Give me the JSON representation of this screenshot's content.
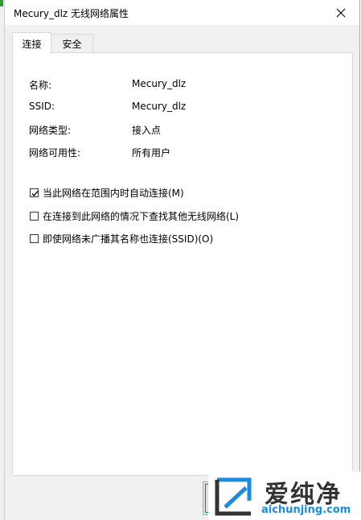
{
  "window": {
    "title": "Mecury_dlz 无线网络属性",
    "close_glyph": "✕"
  },
  "tabs": [
    {
      "label": "连接",
      "active": true
    },
    {
      "label": "安全",
      "active": false
    }
  ],
  "properties": [
    {
      "label": "名称:",
      "value": "Mecury_dlz"
    },
    {
      "label": "SSID:",
      "value": "Mecury_dlz"
    },
    {
      "label": "网络类型:",
      "value": "接入点"
    },
    {
      "label": "网络可用性:",
      "value": "所有用户"
    }
  ],
  "options": [
    {
      "label": "当此网络在范围内时自动连接(M)",
      "checked": true
    },
    {
      "label": "在连接到此网络的情况下查找其他无线网络(L)",
      "checked": false
    },
    {
      "label": "即使网络未广播其名称也连接(SSID)(O)",
      "checked": false
    }
  ],
  "watermark": {
    "text": "爱纯净",
    "url": "aichunjing.com",
    "color": "#1a8be0"
  },
  "icons": {
    "close": "close-icon",
    "check": "checkmark-icon"
  }
}
